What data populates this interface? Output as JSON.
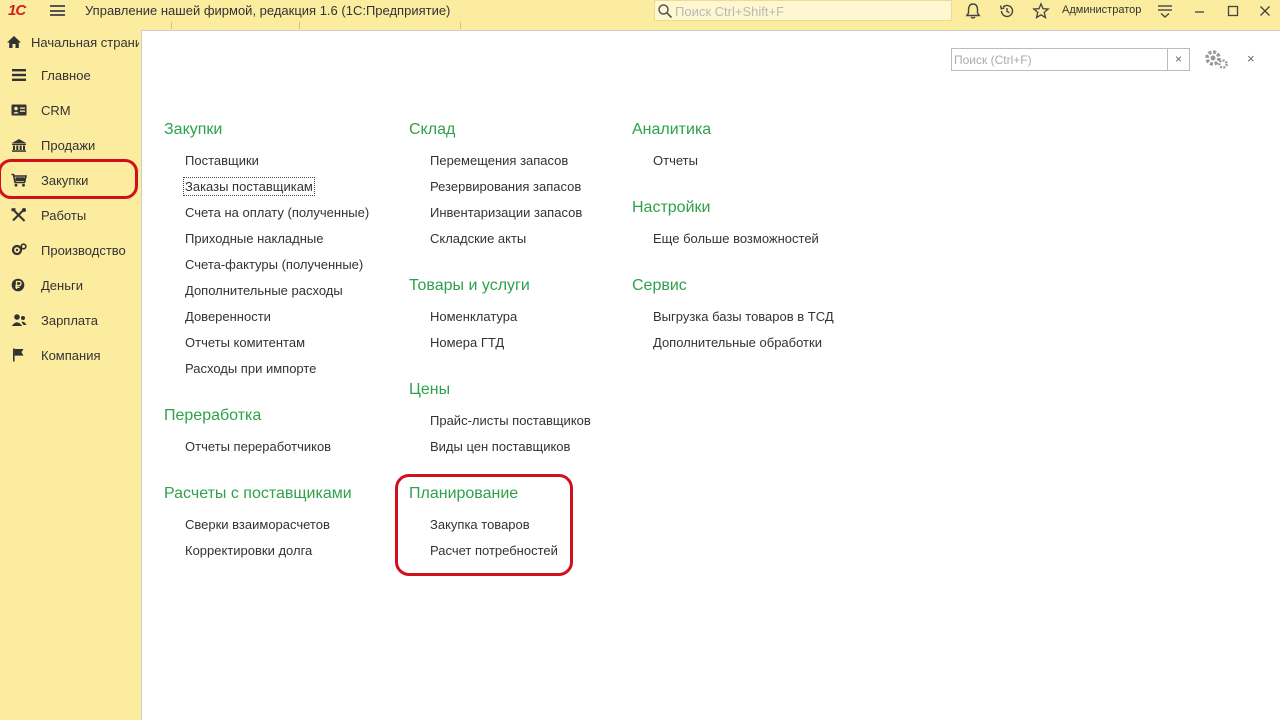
{
  "window": {
    "logo": "1С",
    "title": "Управление нашей фирмой, редакция 1.6  (1С:Предприятие)",
    "search_placeholder": "Поиск Ctrl+Shift+F",
    "user": "Администратор"
  },
  "sidebar": {
    "home": "Начальная страница",
    "items": [
      {
        "label": "Главное",
        "icon": "list-icon"
      },
      {
        "label": "CRM",
        "icon": "contact-card-icon"
      },
      {
        "label": "Продажи",
        "icon": "shop-icon"
      },
      {
        "label": "Закупки",
        "icon": "cart-icon",
        "highlighted": true
      },
      {
        "label": "Работы",
        "icon": "tools-icon"
      },
      {
        "label": "Производство",
        "icon": "factory-icon"
      },
      {
        "label": "Деньги",
        "icon": "ruble-icon"
      },
      {
        "label": "Зарплата",
        "icon": "people-icon"
      },
      {
        "label": "Компания",
        "icon": "flag-icon"
      }
    ]
  },
  "panel": {
    "search_placeholder": "Поиск (Ctrl+F)",
    "clear_label": "×",
    "close_label": "×"
  },
  "sections": {
    "zakupki": {
      "title": "Закупки",
      "items": [
        "Поставщики",
        "Заказы поставщикам",
        "Счета на оплату (полученные)",
        "Приходные накладные",
        "Счета-фактуры (полученные)",
        "Дополнительные расходы",
        "Доверенности",
        "Отчеты комитентам",
        "Расходы при импорте"
      ]
    },
    "pererabotka": {
      "title": "Переработка",
      "items": [
        "Отчеты переработчиков"
      ]
    },
    "raschety": {
      "title": "Расчеты с поставщиками",
      "items": [
        "Сверки взаиморасчетов",
        "Корректировки долга"
      ]
    },
    "sklad": {
      "title": "Склад",
      "items": [
        "Перемещения запасов",
        "Резервирования запасов",
        "Инвентаризации запасов",
        "Складские акты"
      ]
    },
    "tovary": {
      "title": "Товары и услуги",
      "items": [
        "Номенклатура",
        "Номера ГТД"
      ]
    },
    "ceny": {
      "title": "Цены",
      "items": [
        "Прайс-листы поставщиков",
        "Виды цен поставщиков"
      ]
    },
    "planirovanie": {
      "title": "Планирование",
      "items": [
        "Закупка товаров",
        "Расчет потребностей"
      ]
    },
    "analitika": {
      "title": "Аналитика",
      "items": [
        "Отчеты"
      ]
    },
    "nastroiki": {
      "title": "Настройки",
      "items": [
        "Еще больше возможностей"
      ]
    },
    "servis": {
      "title": "Сервис",
      "items": [
        "Выгрузка базы товаров в ТСД",
        "Дополнительные обработки"
      ]
    }
  },
  "colors": {
    "accent_green": "#2ea14a",
    "highlight_red": "#d0101c",
    "sidebar_bg": "#fbeca0"
  }
}
